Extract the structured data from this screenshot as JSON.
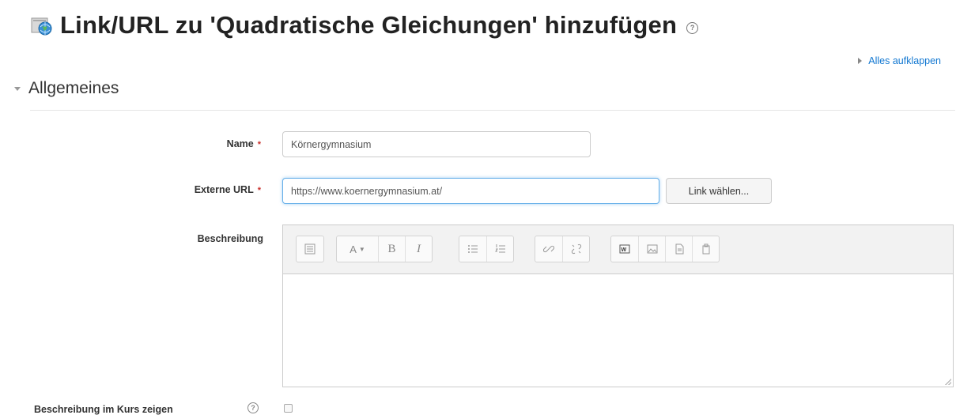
{
  "page": {
    "title": "Link/URL zu 'Quadratische Gleichungen' hinzufügen",
    "title_icon": "url-globe-icon",
    "help_icon": "help-icon",
    "expand_all": "Alles aufklappen"
  },
  "section": {
    "title": "Allgemeines"
  },
  "form": {
    "name": {
      "label": "Name",
      "required_mark": "*",
      "value": "Körnergymnasium"
    },
    "url": {
      "label": "Externe URL",
      "required_mark": "*",
      "value": "https://www.koernergymnasium.at/",
      "choose_link_button": "Link wählen..."
    },
    "description": {
      "label": "Beschreibung",
      "content": ""
    },
    "show_description": {
      "label": "Beschreibung im Kurs zeigen",
      "checked": false
    }
  },
  "toolbar": {
    "groups": [
      [
        "toggle-toolbar-icon"
      ],
      [
        "font-style-dropdown-icon",
        "bold-icon",
        "italic-icon"
      ],
      [
        "unordered-list-icon",
        "ordered-list-icon"
      ],
      [
        "link-icon",
        "unlink-icon"
      ],
      [
        "media-icon",
        "image-icon",
        "file-icon",
        "paste-icon"
      ]
    ],
    "font_glyph": "A",
    "bold_glyph": "B",
    "italic_glyph": "I"
  },
  "colors": {
    "link": "#1177d1",
    "required": "#c9302c",
    "focus": "#66afe9",
    "title": "#222222"
  }
}
